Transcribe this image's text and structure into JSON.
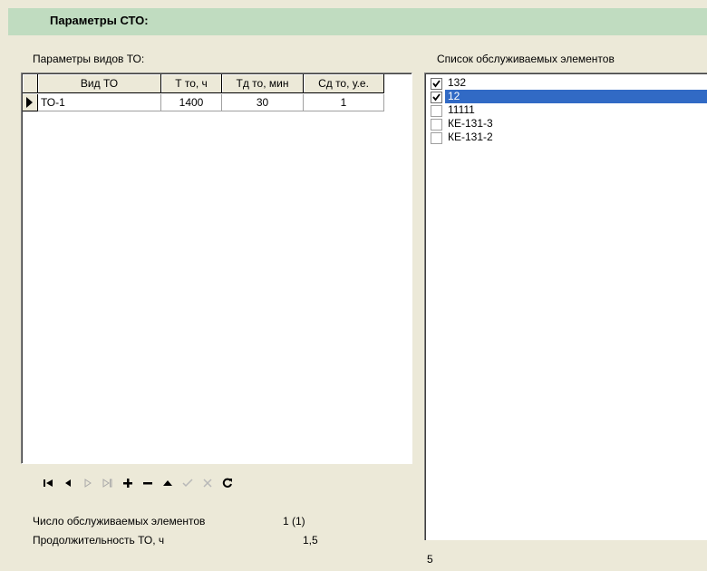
{
  "header": {
    "title": "Параметры СТО:"
  },
  "left": {
    "section_label": "Параметры видов ТО:",
    "grid": {
      "columns": [
        "Вид ТО",
        "Т то, ч",
        "Тд то, мин",
        "Сд то, у.е."
      ],
      "rows": [
        {
          "cells": [
            "ТО-1",
            "1400",
            "30",
            "1"
          ],
          "current": true
        }
      ]
    },
    "navigator": [
      "first-icon",
      "prior-icon",
      "next-icon",
      "last-icon",
      "insert-icon",
      "delete-icon",
      "edit-icon",
      "post-icon",
      "cancel-icon",
      "refresh-icon"
    ],
    "stats": {
      "elements_label": "Число обслуживаемых элементов",
      "elements_value": "1 (1)",
      "duration_label": "Продолжительность ТО, ч",
      "duration_value": "1,5"
    }
  },
  "right": {
    "section_label": "Список обслуживаемых элементов",
    "items": [
      {
        "label": "132",
        "checked": true,
        "selected": false
      },
      {
        "label": "12",
        "checked": true,
        "selected": true
      },
      {
        "label": "11111",
        "checked": false,
        "selected": false
      },
      {
        "label": "КЕ-131-3",
        "checked": false,
        "selected": false
      },
      {
        "label": "КЕ-131-2",
        "checked": false,
        "selected": false
      }
    ],
    "footer_value": "5"
  },
  "colors": {
    "header_bg": "#c0dcc0",
    "selection": "#316ac5",
    "window_bg": "#ece9d8"
  }
}
